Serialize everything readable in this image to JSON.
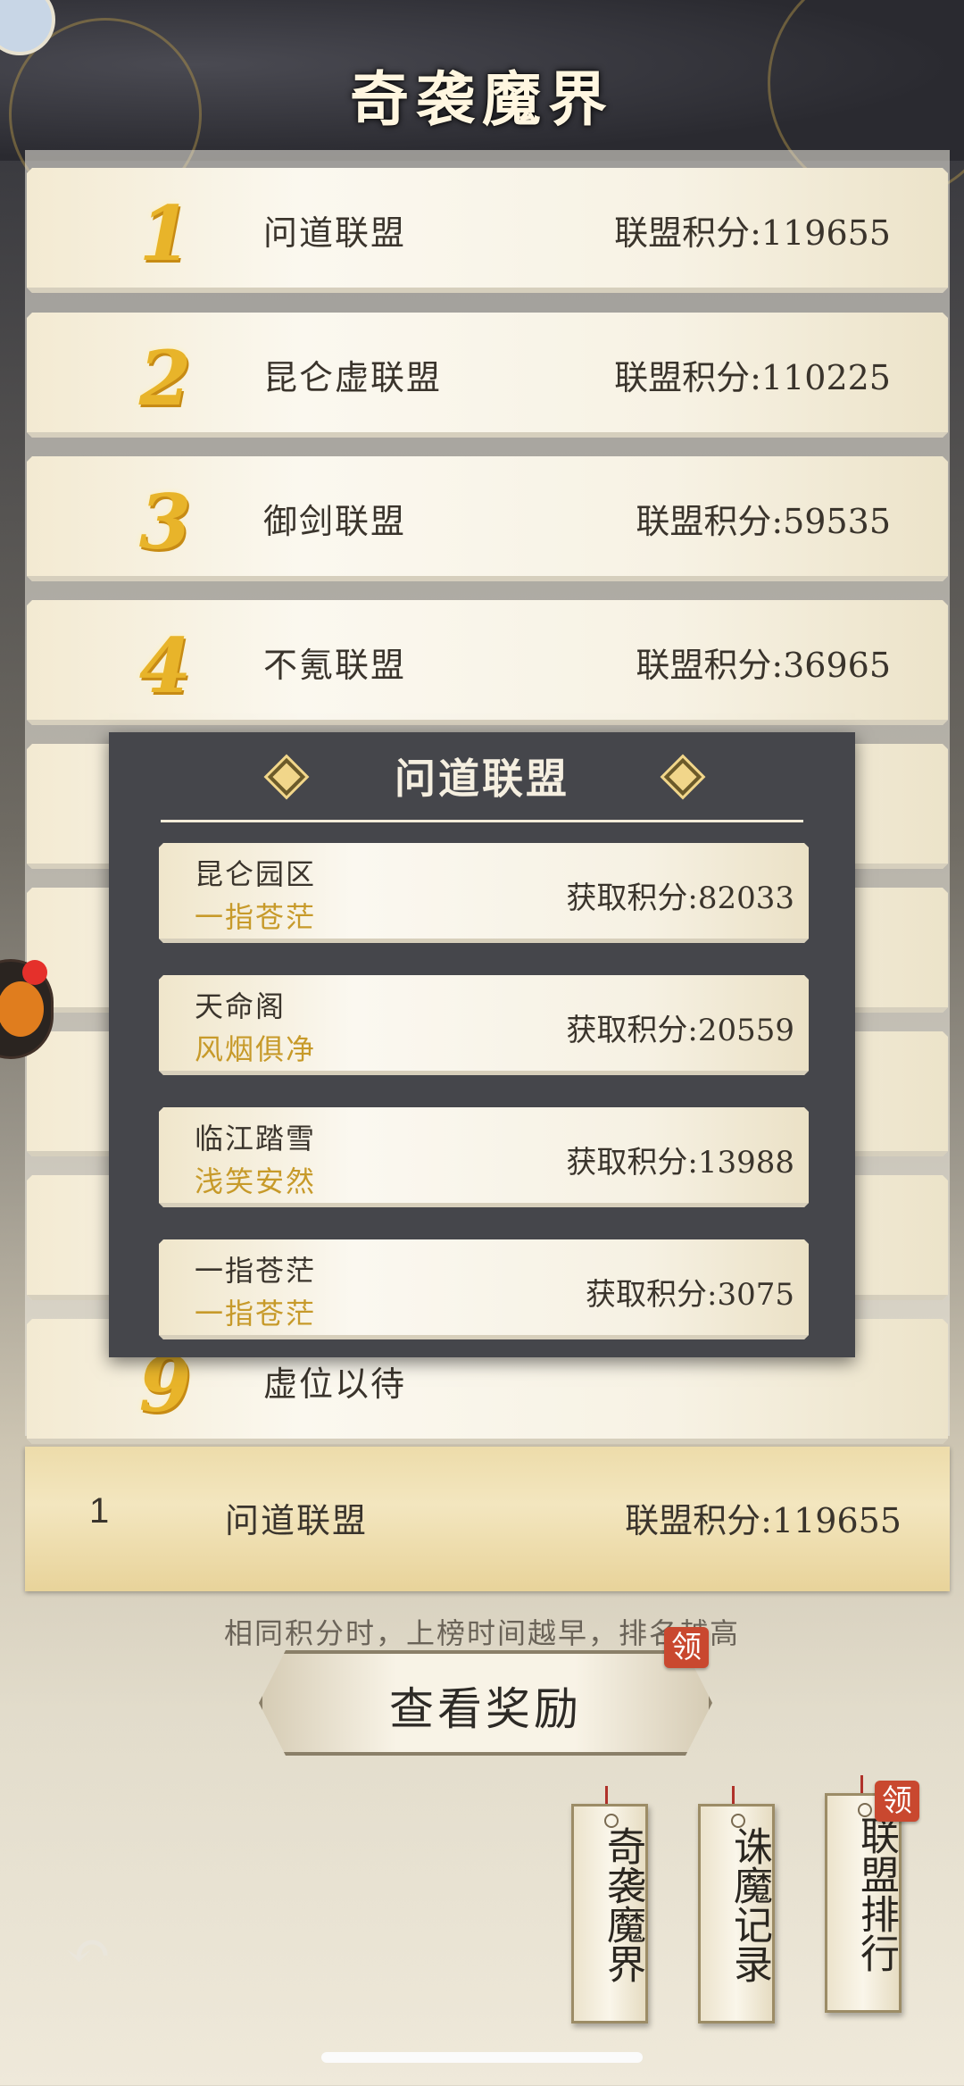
{
  "header": {
    "title": "奇袭魔界"
  },
  "ranking": {
    "rows": [
      {
        "rank": "1",
        "name": "问道联盟",
        "score": "联盟积分:119655"
      },
      {
        "rank": "2",
        "name": "昆仑虚联盟",
        "score": "联盟积分:110225"
      },
      {
        "rank": "3",
        "name": "御剑联盟",
        "score": "联盟积分:59535"
      },
      {
        "rank": "4",
        "name": "不氪联盟",
        "score": "联盟积分:36965"
      },
      {
        "rank": "9",
        "name": "虚位以待",
        "score": ""
      }
    ]
  },
  "my_rank": {
    "rank": "1",
    "name": "问道联盟",
    "score": "联盟积分:119655"
  },
  "tip": "相同积分时，上榜时间越早，排名越高",
  "reward_button": {
    "label": "查看奖励",
    "badge": "领"
  },
  "popup": {
    "title": "问道联盟",
    "members": [
      {
        "server": "昆仑园区",
        "player": "一指苍茫",
        "score": "获取积分:82033"
      },
      {
        "server": "天命阁",
        "player": "风烟俱净",
        "score": "获取积分:20559"
      },
      {
        "server": "临江踏雪",
        "player": "浅笑安然",
        "score": "获取积分:13988"
      },
      {
        "server": "一指苍茫",
        "player": "一指苍茫",
        "score": "获取积分:3075"
      }
    ]
  },
  "bottom_tabs": [
    {
      "label": "奇袭魔界"
    },
    {
      "label": "诛魔记录"
    },
    {
      "label": "联盟排行",
      "badge": "领"
    }
  ],
  "icons": {
    "back": "back-arrow-icon",
    "avatar": "avatar-icon",
    "side": "pet-avatar-icon"
  }
}
